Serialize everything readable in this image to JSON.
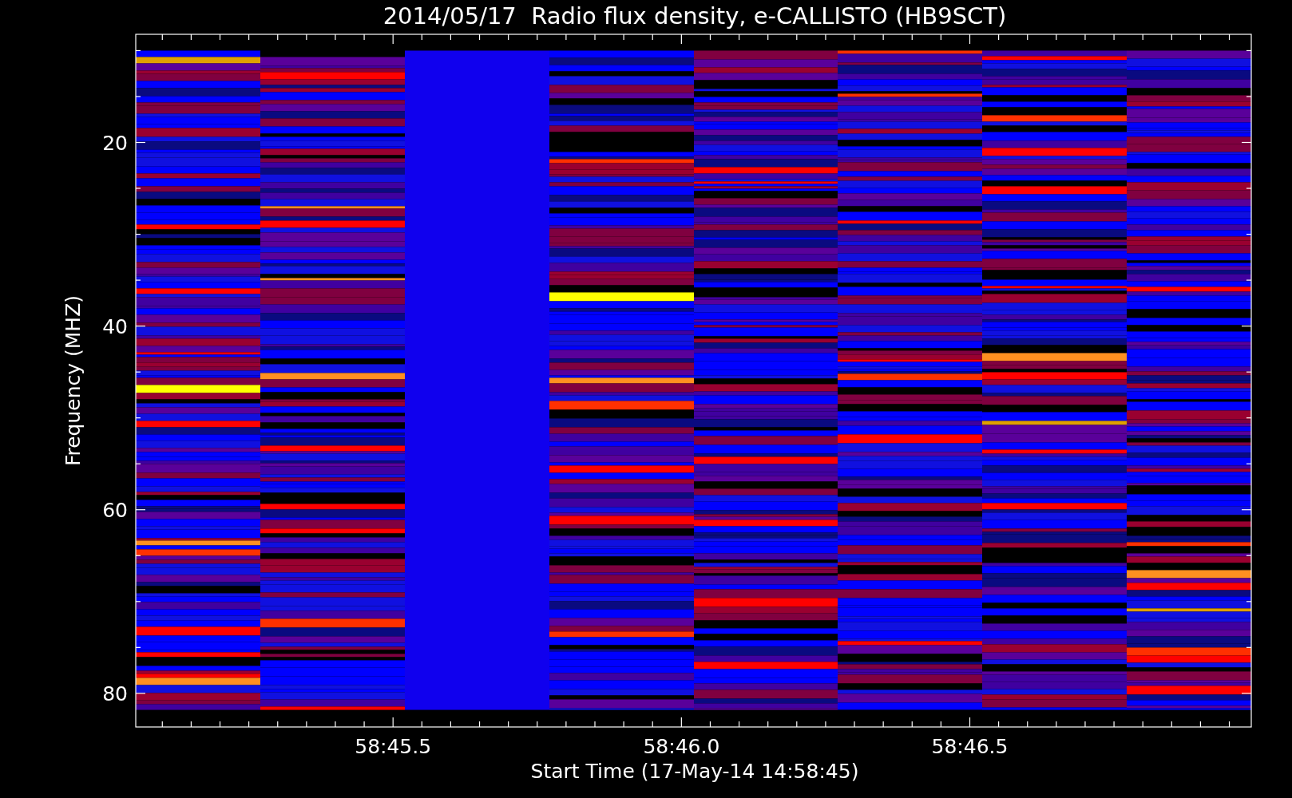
{
  "title": "2014/05/17  Radio flux density, e-CALLISTO (HB9SCT)",
  "plot": {
    "y_axis_title": "Frequency (MHZ)",
    "y_tick_labels": [
      "20",
      "40",
      "60",
      "80"
    ],
    "x_tick_labels": [
      "58:45.5",
      "58:46.0",
      "58:46.5"
    ],
    "x_axis_title": "Start Time (17-May-14 14:58:45)"
  }
}
